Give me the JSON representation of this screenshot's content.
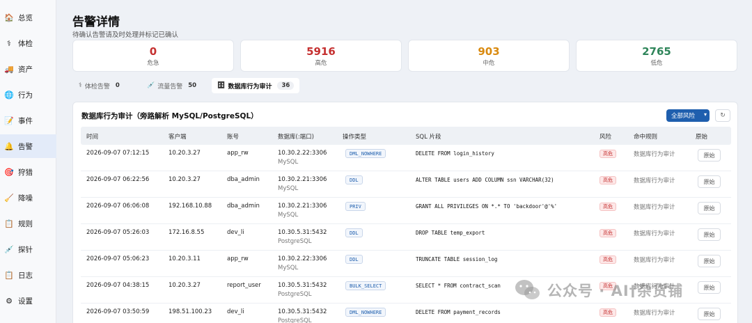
{
  "colors": {
    "sidebar_active": "#e3ebf9",
    "primary": "#1f5fae",
    "danger": "#c53030",
    "medium": "#d98a10",
    "low": "#2f855a"
  },
  "sidebar": {
    "items": [
      {
        "label": "总览",
        "icon": "house-icon",
        "glyph": "🏠"
      },
      {
        "label": "体检",
        "icon": "stethoscope-icon",
        "glyph": "⚕"
      },
      {
        "label": "资产",
        "icon": "truck-icon",
        "glyph": "🚚"
      },
      {
        "label": "行为",
        "icon": "globe-icon",
        "glyph": "🌐"
      },
      {
        "label": "事件",
        "icon": "document-icon",
        "glyph": "📝"
      },
      {
        "label": "告警",
        "icon": "bell-icon",
        "glyph": "🔔",
        "active": true
      },
      {
        "label": "狩猎",
        "icon": "target-icon",
        "glyph": "🎯"
      },
      {
        "label": "降噪",
        "icon": "broom-icon",
        "glyph": "🧹"
      },
      {
        "label": "规则",
        "icon": "clipboard-icon",
        "glyph": "📋"
      },
      {
        "label": "探针",
        "icon": "probe-icon",
        "glyph": "💉"
      },
      {
        "label": "日志",
        "icon": "log-icon",
        "glyph": "📋"
      },
      {
        "label": "设置",
        "icon": "gear-icon",
        "glyph": "⚙"
      }
    ]
  },
  "header": {
    "title": "告警详情",
    "subtitle": "待确认告警请及时处理并标记已确认"
  },
  "stats": [
    {
      "value": "0",
      "label": "危急",
      "color": "#c53030"
    },
    {
      "value": "5916",
      "label": "高危",
      "color": "#c53030"
    },
    {
      "value": "903",
      "label": "中危",
      "color": "#d98a10"
    },
    {
      "value": "2765",
      "label": "低危",
      "color": "#2f855a"
    }
  ],
  "tabs": [
    {
      "label": "体检告警",
      "count": "0",
      "icon": "stethoscope-icon",
      "glyph": "⚕"
    },
    {
      "label": "流量告警",
      "count": "50",
      "icon": "syringe-icon",
      "glyph": "💉"
    },
    {
      "label": "数据库行为审计",
      "count": "36",
      "icon": "database-icon",
      "glyph": "🗄",
      "active": true
    }
  ],
  "panel": {
    "title": "数据库行为审计（旁路解析 MySQL/PostgreSQL）",
    "risk_filter": "全部风险",
    "refresh_glyph": "↻"
  },
  "table": {
    "columns": [
      "时间",
      "客户端",
      "账号",
      "数据库(:端口)",
      "操作类型",
      "SQL 片段",
      "风险",
      "命中规则",
      "原始"
    ],
    "rows": [
      {
        "time": "2026-09-07 07:12:15",
        "client": "10.20.3.27",
        "account": "app_rw",
        "db": "10.30.2.22:3306",
        "engine": "MySQL",
        "op": "DML_NOWHERE",
        "sql": "DELETE FROM login_history",
        "risk": "高危",
        "rule": "数据库行为审计",
        "raw": "原始"
      },
      {
        "time": "2026-09-07 06:22:56",
        "client": "10.20.3.27",
        "account": "dba_admin",
        "db": "10.30.2.21:3306",
        "engine": "MySQL",
        "op": "DDL",
        "sql": "ALTER TABLE users ADD COLUMN ssn VARCHAR(32)",
        "risk": "高危",
        "rule": "数据库行为审计",
        "raw": "原始"
      },
      {
        "time": "2026-09-07 06:06:08",
        "client": "192.168.10.88",
        "account": "dba_admin",
        "db": "10.30.2.21:3306",
        "engine": "MySQL",
        "op": "PRIV",
        "sql": "GRANT ALL PRIVILEGES ON *.* TO 'backdoor'@'%'",
        "risk": "高危",
        "rule": "数据库行为审计",
        "raw": "原始"
      },
      {
        "time": "2026-09-07 05:26:03",
        "client": "172.16.8.55",
        "account": "dev_li",
        "db": "10.30.5.31:5432",
        "engine": "PostgreSQL",
        "op": "DDL",
        "sql": "DROP TABLE temp_export",
        "risk": "高危",
        "rule": "数据库行为审计",
        "raw": "原始"
      },
      {
        "time": "2026-09-07 05:06:23",
        "client": "10.20.3.11",
        "account": "app_rw",
        "db": "10.30.2.22:3306",
        "engine": "MySQL",
        "op": "DDL",
        "sql": "TRUNCATE TABLE session_log",
        "risk": "高危",
        "rule": "数据库行为审计",
        "raw": "原始"
      },
      {
        "time": "2026-09-07 04:38:15",
        "client": "10.20.3.27",
        "account": "report_user",
        "db": "10.30.5.31:5432",
        "engine": "PostgreSQL",
        "op": "BULK_SELECT",
        "sql": "SELECT * FROM contract_scan",
        "risk": "高危",
        "rule": "数据库行为审计",
        "raw": "原始"
      },
      {
        "time": "2026-09-07 03:50:59",
        "client": "198.51.100.23",
        "account": "dev_li",
        "db": "10.30.5.31:5432",
        "engine": "PostgreSQL",
        "op": "DML_NOWHERE",
        "sql": "DELETE FROM payment_records",
        "risk": "高危",
        "rule": "数据库行为审计",
        "raw": "原始"
      }
    ]
  },
  "watermark": {
    "text": "公众号 · AI†杂货铺",
    "icon": "wechat-logo-icon"
  }
}
